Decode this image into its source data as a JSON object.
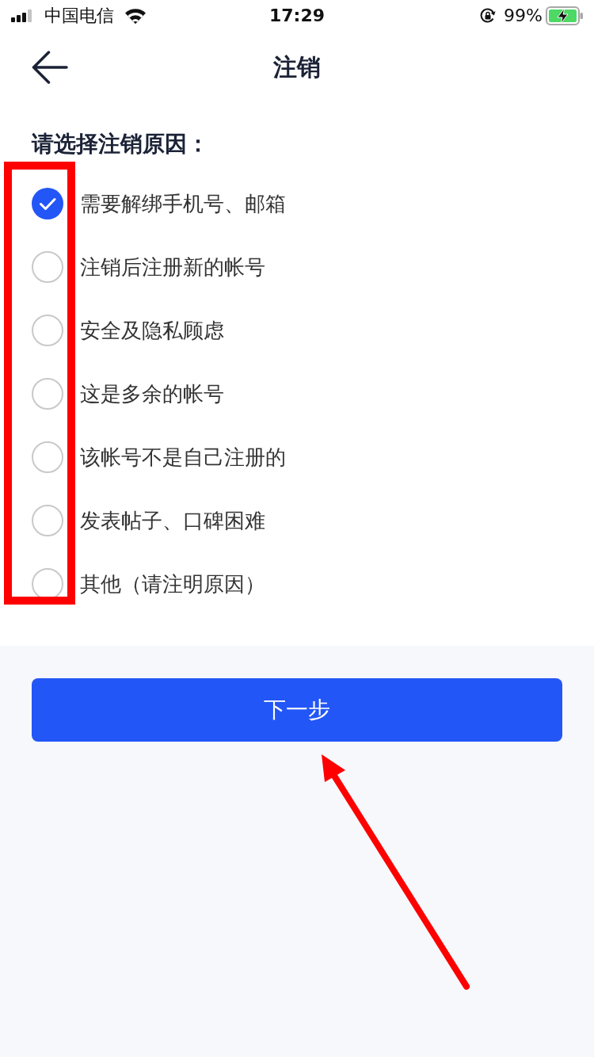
{
  "status_bar": {
    "carrier": "中国电信",
    "time": "17:29",
    "orientation_lock": true,
    "battery": "99%",
    "charging": true
  },
  "nav": {
    "title": "注销"
  },
  "prompt": "请选择注销原因：",
  "reasons": [
    {
      "label": "需要解绑手机号、邮箱",
      "selected": true
    },
    {
      "label": "注销后注册新的帐号",
      "selected": false
    },
    {
      "label": "安全及隐私顾虑",
      "selected": false
    },
    {
      "label": "这是多余的帐号",
      "selected": false
    },
    {
      "label": "该帐号不是自己注册的",
      "selected": false
    },
    {
      "label": "发表帖子、口碑困难",
      "selected": false
    },
    {
      "label": "其他（请注明原因）",
      "selected": false
    }
  ],
  "next_button": {
    "label": "下一步"
  }
}
